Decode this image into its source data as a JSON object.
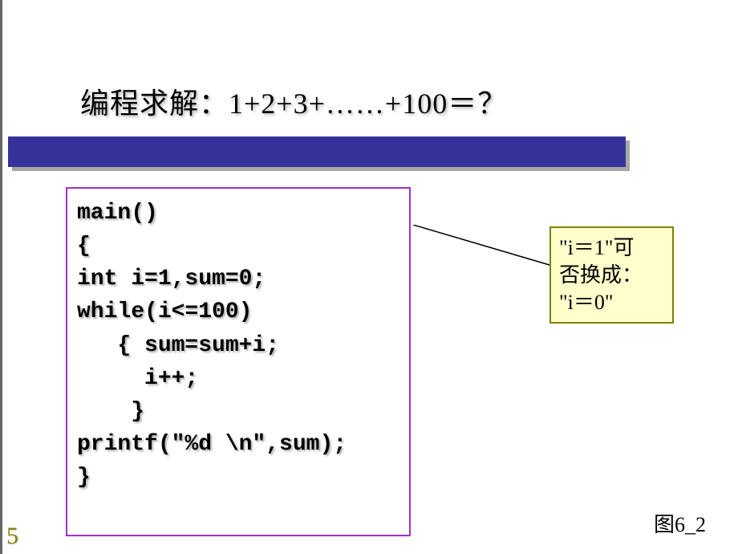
{
  "title": "编程求解：1+2+3+……+100＝？",
  "code": {
    "l1": "main()",
    "l2": "{",
    "l3": "int i=1,sum=0;",
    "l4": "while(i<=100)",
    "l5": "   { sum=sum+i;",
    "l6": "     i++;",
    "l7": "    }",
    "l8": "printf(\"%d \\n\",sum);",
    "l9": "}"
  },
  "callout": {
    "line1": "\"i＝1\"可",
    "line2": "否换成：",
    "line3": "\"i＝0\""
  },
  "page_number": "5",
  "figure_label": "图6_2"
}
